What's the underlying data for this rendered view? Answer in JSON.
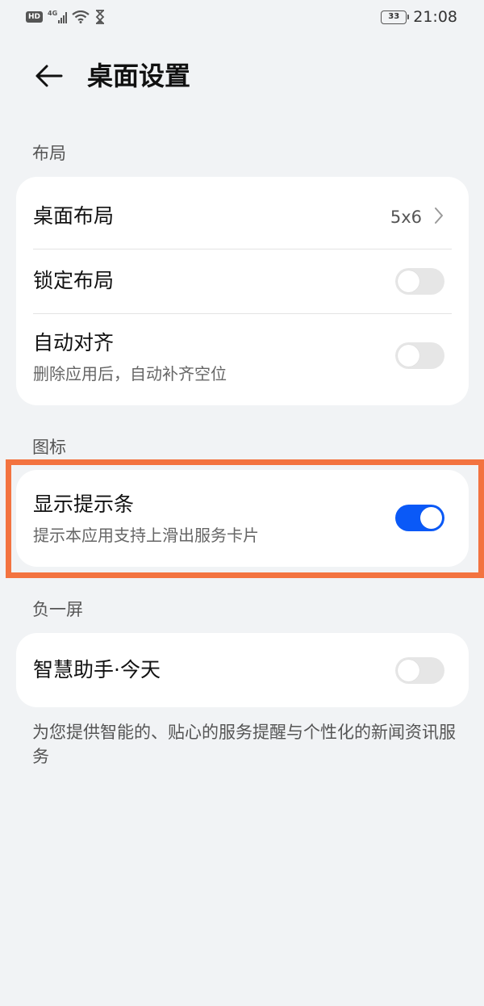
{
  "status_bar": {
    "left_badge": "HD",
    "network": "4G",
    "battery": "33",
    "time": "21:08"
  },
  "header": {
    "back_icon": "arrow-left-icon",
    "title": "桌面设置"
  },
  "sections": {
    "layout": {
      "title": "布局",
      "desktop_layout": {
        "label": "桌面布局",
        "value": "5x6"
      },
      "lock_layout": {
        "label": "锁定布局",
        "toggle_on": false
      },
      "auto_align": {
        "label": "自动对齐",
        "description": "删除应用后，自动补齐空位",
        "toggle_on": false
      }
    },
    "icons": {
      "title": "图标",
      "show_hint_bar": {
        "label": "显示提示条",
        "description": "提示本应用支持上滑出服务卡片",
        "toggle_on": true
      }
    },
    "minus_one": {
      "title": "负一屏",
      "smart_assistant": {
        "label": "智慧助手·今天",
        "toggle_on": false
      },
      "note": "为您提供智能的、贴心的服务提醒与个性化的新闻资讯服务"
    }
  },
  "colors": {
    "accent": "#0a59f7",
    "highlight_border": "#f37340",
    "background": "#f1f3f5"
  }
}
